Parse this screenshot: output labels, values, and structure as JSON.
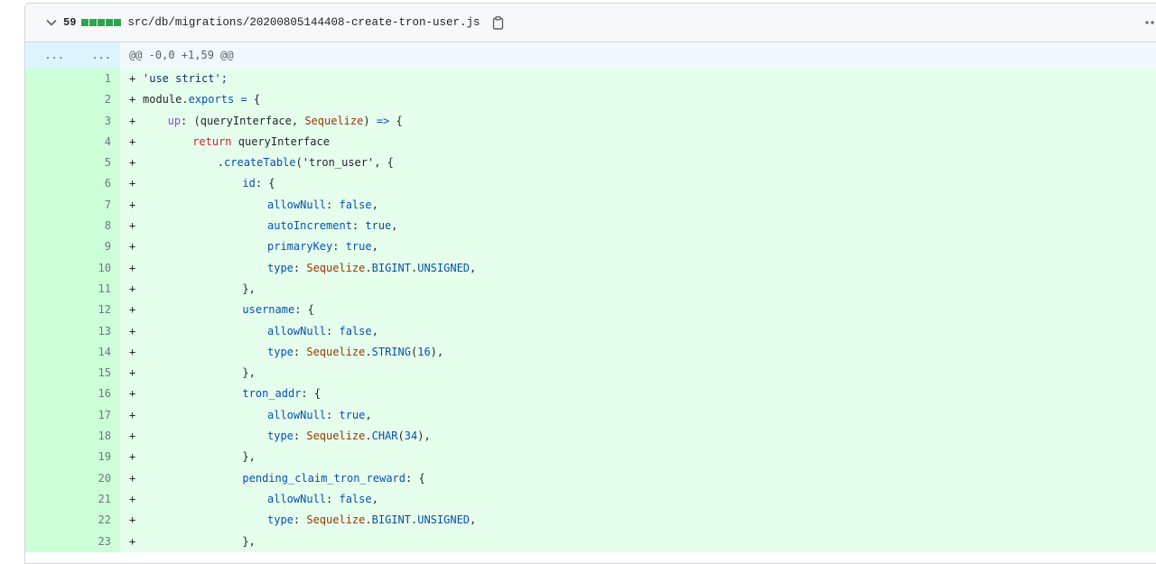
{
  "file": {
    "change_count": "59",
    "path": "src/db/migrations/20200805144408-create-tron-user.js",
    "diffstat_blocks": 5
  },
  "hunk": {
    "old_expander": "...",
    "new_expander": "...",
    "header": "@@ -0,0 +1,59 @@"
  },
  "lines": [
    {
      "n": "1",
      "indent": 0,
      "tokens": [
        {
          "t": "'use strict';",
          "c": "str"
        }
      ]
    },
    {
      "n": "2",
      "indent": 0,
      "tokens": [
        {
          "t": "module",
          "c": "plain"
        },
        {
          "t": ".",
          "c": "plain"
        },
        {
          "t": "exports",
          "c": "prop"
        },
        {
          "t": " = ",
          "c": "prop"
        },
        {
          "t": "{",
          "c": "plain"
        }
      ]
    },
    {
      "n": "3",
      "indent": 4,
      "tokens": [
        {
          "t": "up",
          "c": "ent"
        },
        {
          "t": ": (queryInterface, ",
          "c": "plain"
        },
        {
          "t": "Sequelize",
          "c": "cls"
        },
        {
          "t": ") ",
          "c": "plain"
        },
        {
          "t": "=>",
          "c": "prop"
        },
        {
          "t": " {",
          "c": "plain"
        }
      ]
    },
    {
      "n": "4",
      "indent": 8,
      "tokens": [
        {
          "t": "return",
          "c": "kw"
        },
        {
          "t": " queryInterface",
          "c": "plain"
        }
      ]
    },
    {
      "n": "5",
      "indent": 12,
      "tokens": [
        {
          "t": ".",
          "c": "plain"
        },
        {
          "t": "createTable",
          "c": "prop"
        },
        {
          "t": "('tron_user', {",
          "c": "plain"
        }
      ]
    },
    {
      "n": "6",
      "indent": 16,
      "tokens": [
        {
          "t": "id",
          "c": "prop"
        },
        {
          "t": ": {",
          "c": "plain"
        }
      ]
    },
    {
      "n": "7",
      "indent": 20,
      "tokens": [
        {
          "t": "allowNull",
          "c": "prop"
        },
        {
          "t": ": ",
          "c": "plain"
        },
        {
          "t": "false",
          "c": "prop"
        },
        {
          "t": ",",
          "c": "plain"
        }
      ]
    },
    {
      "n": "8",
      "indent": 20,
      "tokens": [
        {
          "t": "autoIncrement",
          "c": "prop"
        },
        {
          "t": ": ",
          "c": "plain"
        },
        {
          "t": "true",
          "c": "prop"
        },
        {
          "t": ",",
          "c": "plain"
        }
      ]
    },
    {
      "n": "9",
      "indent": 20,
      "tokens": [
        {
          "t": "primaryKey",
          "c": "prop"
        },
        {
          "t": ": ",
          "c": "plain"
        },
        {
          "t": "true",
          "c": "prop"
        },
        {
          "t": ",",
          "c": "plain"
        }
      ]
    },
    {
      "n": "10",
      "indent": 20,
      "tokens": [
        {
          "t": "type",
          "c": "prop"
        },
        {
          "t": ": ",
          "c": "plain"
        },
        {
          "t": "Sequelize",
          "c": "cls"
        },
        {
          "t": ".",
          "c": "plain"
        },
        {
          "t": "BIGINT",
          "c": "prop"
        },
        {
          "t": ".",
          "c": "plain"
        },
        {
          "t": "UNSIGNED",
          "c": "prop"
        },
        {
          "t": ",",
          "c": "plain"
        }
      ]
    },
    {
      "n": "11",
      "indent": 16,
      "tokens": [
        {
          "t": "},",
          "c": "plain"
        }
      ]
    },
    {
      "n": "12",
      "indent": 16,
      "tokens": [
        {
          "t": "username",
          "c": "prop"
        },
        {
          "t": ": {",
          "c": "plain"
        }
      ]
    },
    {
      "n": "13",
      "indent": 20,
      "tokens": [
        {
          "t": "allowNull",
          "c": "prop"
        },
        {
          "t": ": ",
          "c": "plain"
        },
        {
          "t": "false",
          "c": "prop"
        },
        {
          "t": ",",
          "c": "plain"
        }
      ]
    },
    {
      "n": "14",
      "indent": 20,
      "tokens": [
        {
          "t": "type",
          "c": "prop"
        },
        {
          "t": ": ",
          "c": "plain"
        },
        {
          "t": "Sequelize",
          "c": "cls"
        },
        {
          "t": ".",
          "c": "plain"
        },
        {
          "t": "STRING",
          "c": "prop"
        },
        {
          "t": "(",
          "c": "plain"
        },
        {
          "t": "16",
          "c": "prop"
        },
        {
          "t": "),",
          "c": "plain"
        }
      ]
    },
    {
      "n": "15",
      "indent": 16,
      "tokens": [
        {
          "t": "},",
          "c": "plain"
        }
      ]
    },
    {
      "n": "16",
      "indent": 16,
      "tokens": [
        {
          "t": "tron_addr",
          "c": "prop"
        },
        {
          "t": ": {",
          "c": "plain"
        }
      ]
    },
    {
      "n": "17",
      "indent": 20,
      "tokens": [
        {
          "t": "allowNull",
          "c": "prop"
        },
        {
          "t": ": ",
          "c": "plain"
        },
        {
          "t": "true",
          "c": "prop"
        },
        {
          "t": ",",
          "c": "plain"
        }
      ]
    },
    {
      "n": "18",
      "indent": 20,
      "tokens": [
        {
          "t": "type",
          "c": "prop"
        },
        {
          "t": ": ",
          "c": "plain"
        },
        {
          "t": "Sequelize",
          "c": "cls"
        },
        {
          "t": ".",
          "c": "plain"
        },
        {
          "t": "CHAR",
          "c": "prop"
        },
        {
          "t": "(",
          "c": "plain"
        },
        {
          "t": "34",
          "c": "prop"
        },
        {
          "t": "),",
          "c": "plain"
        }
      ]
    },
    {
      "n": "19",
      "indent": 16,
      "tokens": [
        {
          "t": "},",
          "c": "plain"
        }
      ]
    },
    {
      "n": "20",
      "indent": 16,
      "tokens": [
        {
          "t": "pending_claim_tron_reward",
          "c": "prop"
        },
        {
          "t": ": {",
          "c": "plain"
        }
      ]
    },
    {
      "n": "21",
      "indent": 20,
      "tokens": [
        {
          "t": "allowNull",
          "c": "prop"
        },
        {
          "t": ": ",
          "c": "plain"
        },
        {
          "t": "false",
          "c": "prop"
        },
        {
          "t": ",",
          "c": "plain"
        }
      ]
    },
    {
      "n": "22",
      "indent": 20,
      "tokens": [
        {
          "t": "type",
          "c": "prop"
        },
        {
          "t": ": ",
          "c": "plain"
        },
        {
          "t": "Sequelize",
          "c": "cls"
        },
        {
          "t": ".",
          "c": "plain"
        },
        {
          "t": "BIGINT",
          "c": "prop"
        },
        {
          "t": ".",
          "c": "plain"
        },
        {
          "t": "UNSIGNED",
          "c": "prop"
        },
        {
          "t": ",",
          "c": "plain"
        }
      ]
    },
    {
      "n": "23",
      "indent": 16,
      "tokens": [
        {
          "t": "},",
          "c": "plain"
        }
      ]
    }
  ],
  "add_marker": "+",
  "icons": {
    "collapse": "chevron-down-icon",
    "copy": "copy-icon",
    "menu": "kebab-horizontal-icon"
  },
  "colors": {
    "addition_bg": "#e6ffec",
    "addition_num_bg": "#ccffd8",
    "hunk_bg": "#ddf4ff",
    "diffstat_green": "#2da44e"
  }
}
